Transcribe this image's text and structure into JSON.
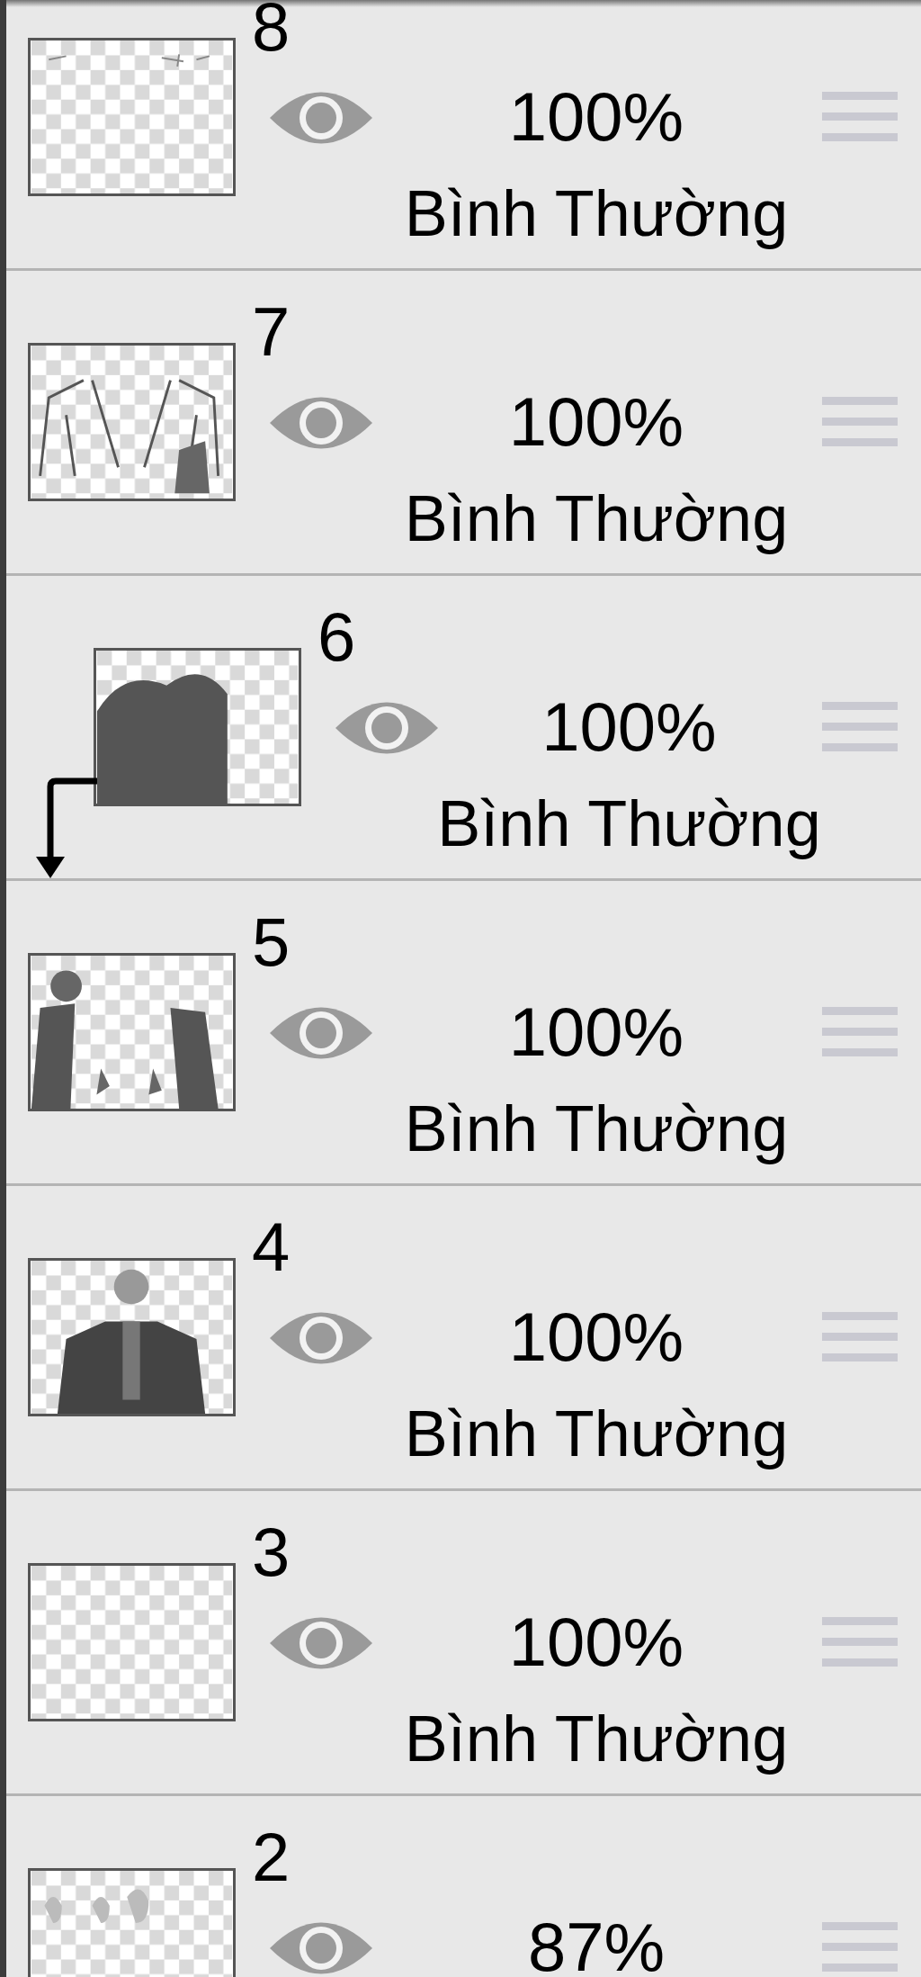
{
  "layers": [
    {
      "number": "8",
      "visible": true,
      "clipping": false,
      "opacity": "100%",
      "blend_mode": "Bình Thường"
    },
    {
      "number": "7",
      "visible": true,
      "clipping": false,
      "opacity": "100%",
      "blend_mode": "Bình Thường"
    },
    {
      "number": "6",
      "visible": true,
      "clipping": true,
      "opacity": "100%",
      "blend_mode": "Bình Thường"
    },
    {
      "number": "5",
      "visible": true,
      "clipping": false,
      "opacity": "100%",
      "blend_mode": "Bình Thường"
    },
    {
      "number": "4",
      "visible": true,
      "clipping": false,
      "opacity": "100%",
      "blend_mode": "Bình Thường"
    },
    {
      "number": "3",
      "visible": true,
      "clipping": false,
      "opacity": "100%",
      "blend_mode": "Bình Thường"
    },
    {
      "number": "2",
      "visible": true,
      "clipping": false,
      "opacity": "87%"
    }
  ]
}
